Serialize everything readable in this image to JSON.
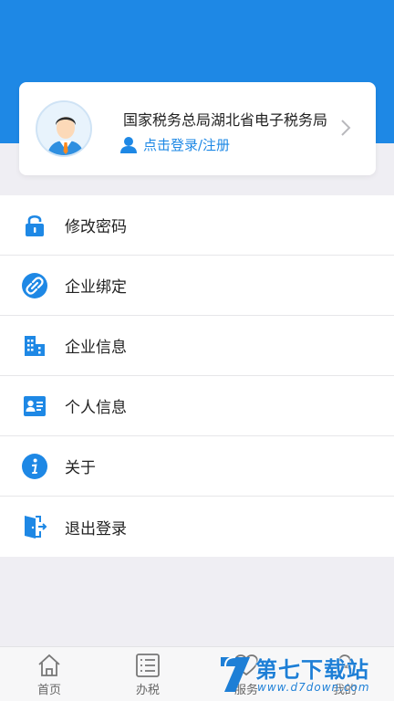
{
  "profile": {
    "org_name": "国家税务总局湖北省电子税务局",
    "login_label": "点击登录/注册",
    "avatar_icon": "user-avatar-icon",
    "arrow_icon": "chevron-right-icon"
  },
  "menu": {
    "items": [
      {
        "label": "修改密码",
        "icon": "lock-icon"
      },
      {
        "label": "企业绑定",
        "icon": "link-icon"
      },
      {
        "label": "企业信息",
        "icon": "building-icon"
      },
      {
        "label": "个人信息",
        "icon": "id-card-icon"
      },
      {
        "label": "关于",
        "icon": "info-icon"
      },
      {
        "label": "退出登录",
        "icon": "logout-icon"
      }
    ]
  },
  "tabbar": {
    "tabs": [
      {
        "label": "首页",
        "icon": "home-icon"
      },
      {
        "label": "办税",
        "icon": "list-icon"
      },
      {
        "label": "服务",
        "icon": "heart-icon"
      },
      {
        "label": "我的",
        "icon": "person-icon"
      }
    ]
  },
  "watermark": {
    "title": "第七下载站",
    "url": "www.d7down.com"
  },
  "colors": {
    "primary": "#1e88e5",
    "background": "#efeef3"
  }
}
